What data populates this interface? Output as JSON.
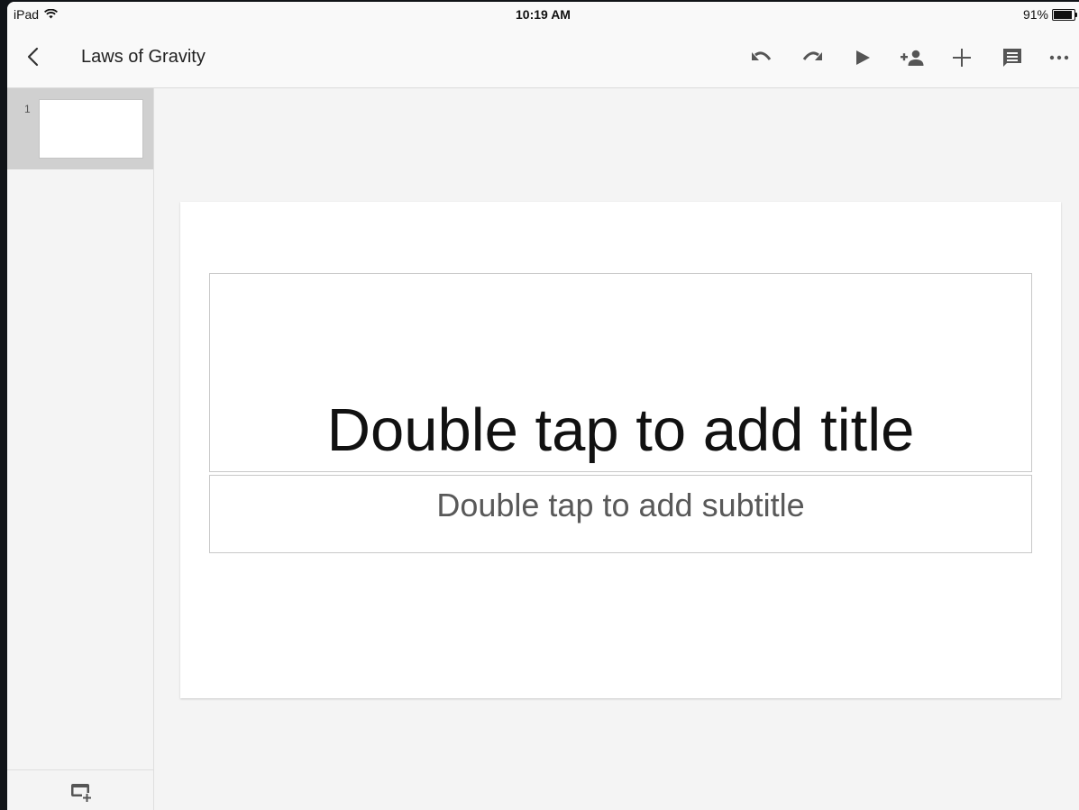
{
  "status_bar": {
    "device": "iPad",
    "time": "10:19 AM",
    "battery_text": "91%",
    "battery_level": 0.91
  },
  "app_bar": {
    "document_title": "Laws of Gravity",
    "icons": [
      "back-chevron-icon",
      "undo-icon",
      "redo-icon",
      "present-play-icon",
      "add-person-icon",
      "insert-plus-icon",
      "comment-icon",
      "more-icon"
    ]
  },
  "sidebar": {
    "slides": [
      {
        "number": "1"
      }
    ]
  },
  "slide": {
    "title_placeholder": "Double tap to add title",
    "subtitle_placeholder": "Double tap to add subtitle"
  },
  "colors": {
    "icon": "#555555",
    "canvas_bg": "#f4f4f4",
    "thumb_selected_bg": "#d0d0d0"
  }
}
